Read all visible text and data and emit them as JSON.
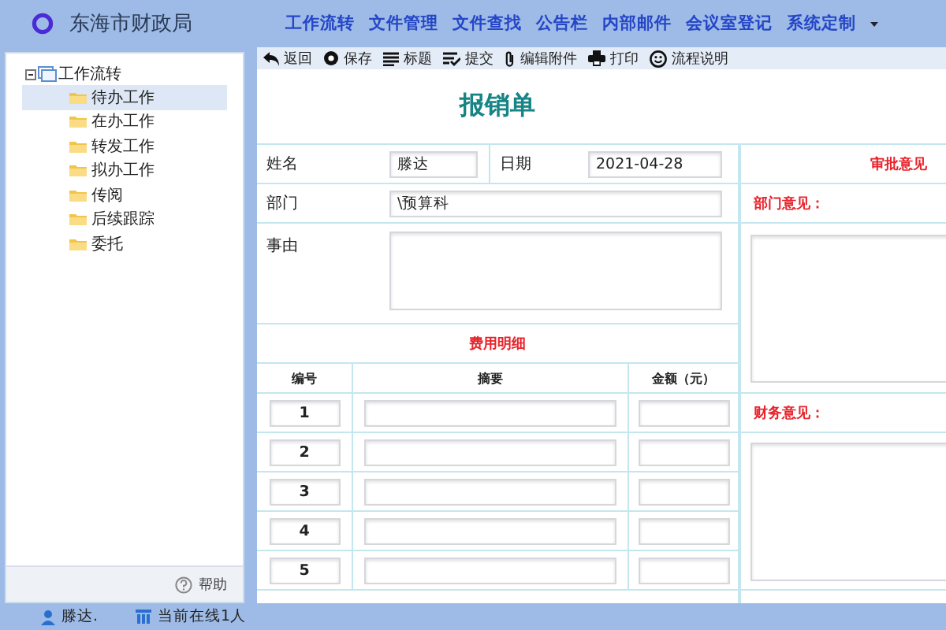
{
  "header": {
    "title": "东海市财政局",
    "nav": [
      "工作流转",
      "文件管理",
      "文件查找",
      "公告栏",
      "内部邮件",
      "会议室登记",
      "系统定制"
    ]
  },
  "sidebar": {
    "tree": {
      "label": "工作流转",
      "expanded": true,
      "children": [
        {
          "label": "待办工作",
          "selected": true
        },
        {
          "label": "在办工作",
          "selected": false
        },
        {
          "label": "转发工作",
          "selected": false
        },
        {
          "label": "拟办工作",
          "selected": false
        },
        {
          "label": "传阅",
          "selected": false
        },
        {
          "label": "后续跟踪",
          "selected": false
        },
        {
          "label": "委托",
          "selected": false
        }
      ]
    },
    "help": "帮助"
  },
  "toolbar": [
    {
      "kind": "back",
      "label": "返回"
    },
    {
      "kind": "save",
      "label": "保存"
    },
    {
      "kind": "title",
      "label": "标题"
    },
    {
      "kind": "submit",
      "label": "提交"
    },
    {
      "kind": "attach",
      "label": "编辑附件"
    },
    {
      "kind": "print",
      "label": "打印"
    },
    {
      "kind": "help",
      "label": "流程说明"
    }
  ],
  "form": {
    "title": "报销单",
    "name": {
      "label": "姓名",
      "value": "滕达"
    },
    "date": {
      "label": "日期",
      "value": "2021-04-28"
    },
    "department": {
      "label": "部门",
      "value": "\\预算科"
    },
    "reason": {
      "label": "事由"
    },
    "expense_title": "费用明细",
    "columns": [
      "编号",
      "摘要",
      "金额（元）"
    ],
    "rows": [
      {
        "number": "1"
      },
      {
        "number": "2"
      },
      {
        "number": "3"
      },
      {
        "number": "4"
      },
      {
        "number": "5"
      }
    ],
    "approval": {
      "title": "审批意见",
      "department_opinion": "部门意见：",
      "finance_opinion": "财务意见："
    }
  },
  "status_bar": {
    "user": "滕达.",
    "online": "当前在线1人"
  }
}
